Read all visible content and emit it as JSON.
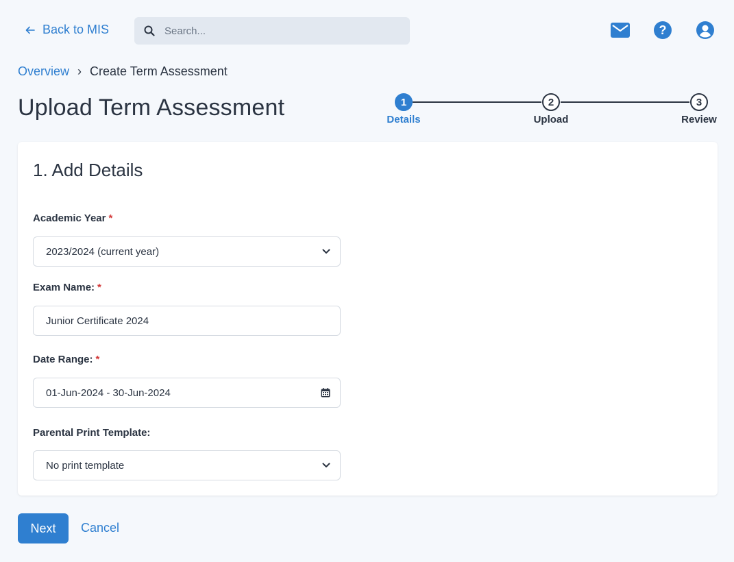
{
  "header": {
    "back_label": "Back to MIS",
    "search_placeholder": "Search...",
    "icons": [
      "mail-icon",
      "help-icon",
      "user-icon"
    ]
  },
  "breadcrumb": {
    "overview": "Overview",
    "separator": "›",
    "current": "Create Term Assessment"
  },
  "page": {
    "title": "Upload Term Assessment"
  },
  "stepper": {
    "steps": [
      {
        "number": "1",
        "label": "Details",
        "active": true
      },
      {
        "number": "2",
        "label": "Upload",
        "active": false
      },
      {
        "number": "3",
        "label": "Review",
        "active": false
      }
    ]
  },
  "form": {
    "title": "1. Add Details",
    "academic_year": {
      "label": "Academic Year",
      "required": "*",
      "value": "2023/2024 (current year)"
    },
    "exam_name": {
      "label": "Exam Name:",
      "required": "*",
      "value": "Junior Certificate 2024"
    },
    "date_range": {
      "label": "Date Range:",
      "required": "*",
      "value": "01-Jun-2024 - 30-Jun-2024"
    },
    "print_template": {
      "label": "Parental Print Template:",
      "value": "No print template"
    }
  },
  "actions": {
    "next_label": "Next",
    "cancel_label": "Cancel"
  },
  "colors": {
    "accent": "#2f7fd0",
    "text": "#2b3442",
    "required": "#d33a3a",
    "background": "#f5f8fc"
  }
}
